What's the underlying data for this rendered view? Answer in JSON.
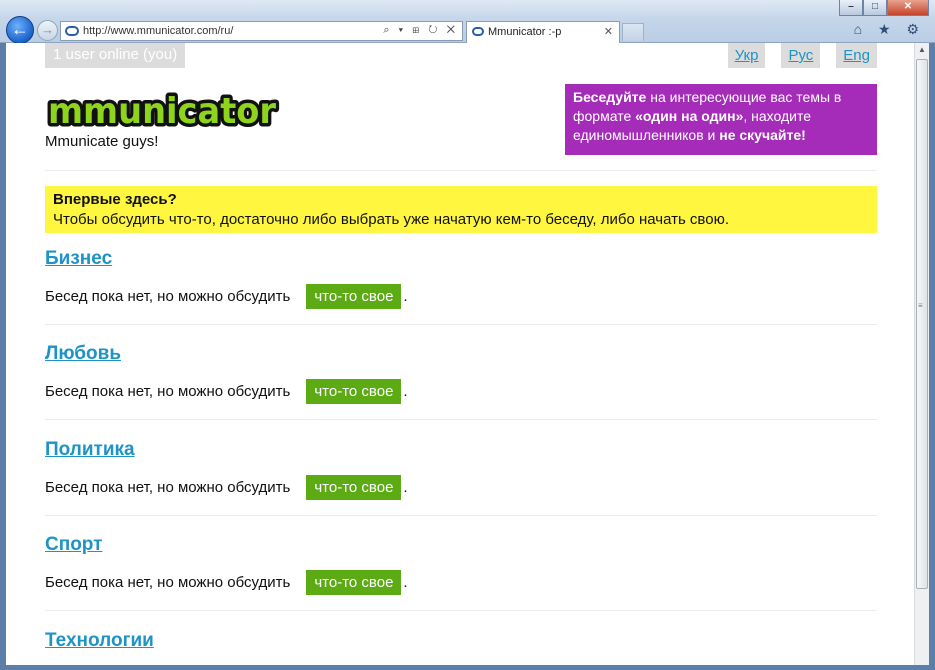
{
  "browser": {
    "url": "http://www.mmunicator.com/ru/",
    "tab_title": "Mmunicator :-p",
    "tab_close": "✕",
    "tools": "⌕ ▾ ⊞ ↻ ✕",
    "back_glyph": "←",
    "forward_glyph": "→",
    "right_icons": "⌂ ★ ⚙",
    "win_min": "–",
    "win_max": "□",
    "win_close": "✕"
  },
  "header": {
    "online_status": "1 user online (you)",
    "languages": [
      "Укр",
      "Рус",
      "Eng"
    ],
    "logo_text": "mmunicator",
    "tagline": "Mmunicate guys!",
    "promo": {
      "b1": "Беседуйте",
      "t1": " на интересующие вас темы в формате ",
      "b2": "«один на один»",
      "t2": ", находите единомышленников и ",
      "b3": "не скучайте!"
    }
  },
  "notice": {
    "heading": "Впервые здесь?",
    "body": "Чтобы обсудить что-то, достаточно либо выбрать уже начатую кем-то беседу, либо начать свою."
  },
  "categories": [
    {
      "title": "Бизнес",
      "empty_text": "Бесед пока нет, но можно обсудить",
      "button": "что-то свое",
      "dot": "."
    },
    {
      "title": "Любовь",
      "empty_text": "Бесед пока нет, но можно обсудить",
      "button": "что-то свое",
      "dot": "."
    },
    {
      "title": "Политика",
      "empty_text": "Бесед пока нет, но можно обсудить",
      "button": "что-то свое",
      "dot": "."
    },
    {
      "title": "Спорт",
      "empty_text": "Бесед пока нет, но можно обсудить",
      "button": "что-то свое",
      "dot": "."
    },
    {
      "title": "Технологии"
    }
  ],
  "colors": {
    "link": "#1e93c6",
    "promo_bg": "#a42cb9",
    "notice_bg": "#fff63f",
    "button_green": "#5caa14",
    "logo_green": "#8ed31c"
  },
  "icons": {
    "back": "back-arrow-icon",
    "forward": "forward-arrow-icon",
    "home": "home-icon",
    "favorites": "star-icon",
    "tools": "gear-icon"
  }
}
